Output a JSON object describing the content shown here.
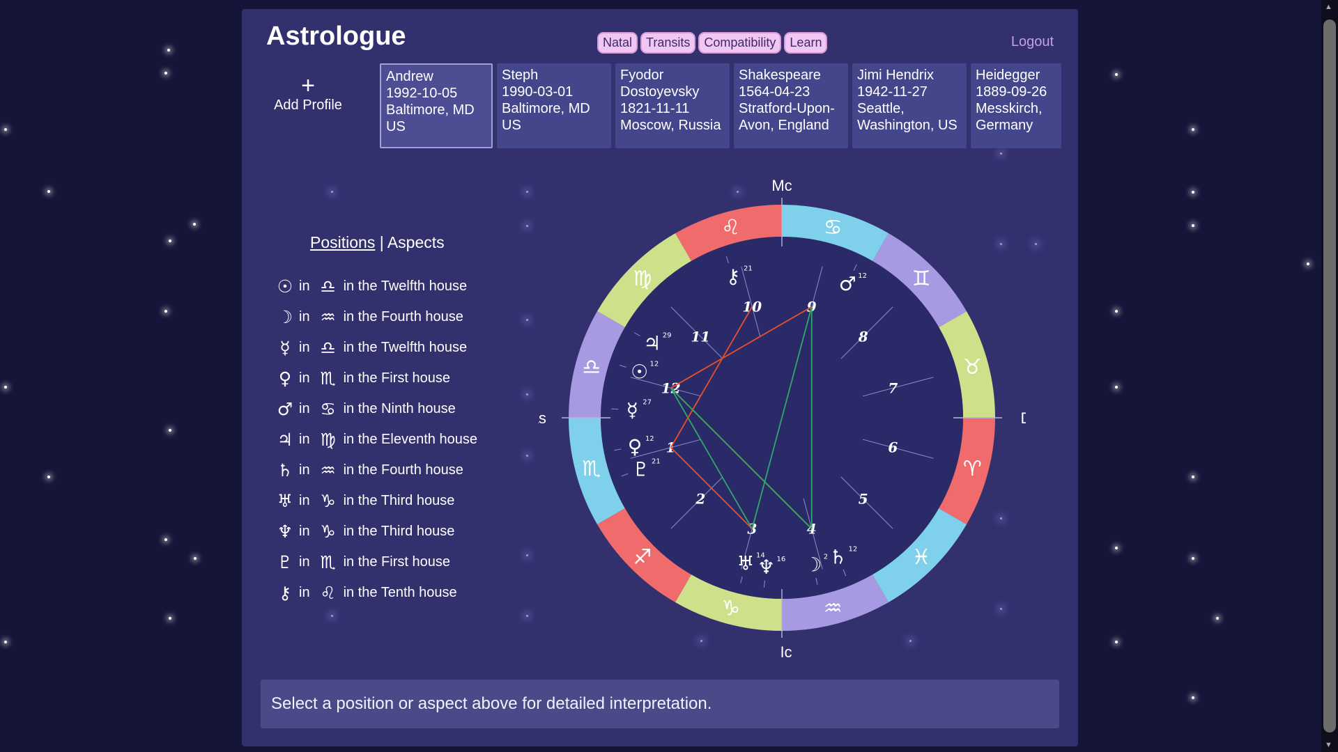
{
  "app": {
    "title": "Astrologue"
  },
  "nav": {
    "items": [
      "Natal",
      "Transits",
      "Compatibility",
      "Learn"
    ],
    "logout": "Logout"
  },
  "add_profile": {
    "icon": "+",
    "label": "Add Profile"
  },
  "profiles": [
    {
      "lines": [
        "Andrew",
        "1992-10-05",
        "Baltimore, MD",
        "US"
      ],
      "active": true
    },
    {
      "lines": [
        "Steph",
        "1990-03-01",
        "Baltimore, MD",
        "US"
      ],
      "active": false
    },
    {
      "lines": [
        "Fyodor",
        "Dostoyevsky",
        "1821-11-11",
        "Moscow, Russia"
      ],
      "active": false
    },
    {
      "lines": [
        "Shakespeare",
        "1564-04-23",
        "Stratford-Upon-",
        "Avon, England"
      ],
      "active": false
    },
    {
      "lines": [
        "Jimi Hendrix",
        "1942-11-27",
        "Seattle,",
        "Washington, US"
      ],
      "active": false
    },
    {
      "lines": [
        "Heidegger",
        "1889-09-26",
        "Messkirch,",
        "Germany"
      ],
      "active": false
    }
  ],
  "tabs": {
    "positions": "Positions",
    "separator": "|",
    "aspects": "Aspects"
  },
  "positions": [
    {
      "planet_icon": "sun-icon",
      "planet_glyph": "☉",
      "in": "in",
      "sign_icon": "libra-icon",
      "sign_glyph": "♎",
      "house": "in the Twelfth house"
    },
    {
      "planet_icon": "moon-icon",
      "planet_glyph": "☽",
      "in": "in",
      "sign_icon": "aquarius-icon",
      "sign_glyph": "♒",
      "house": "in the Fourth house"
    },
    {
      "planet_icon": "mercury-icon",
      "planet_glyph": "☿",
      "in": "in",
      "sign_icon": "libra-icon",
      "sign_glyph": "♎",
      "house": "in the Twelfth house"
    },
    {
      "planet_icon": "venus-icon",
      "planet_glyph": "♀",
      "in": "in",
      "sign_icon": "scorpio-icon",
      "sign_glyph": "♏",
      "house": "in the First house"
    },
    {
      "planet_icon": "mars-icon",
      "planet_glyph": "♂",
      "in": "in",
      "sign_icon": "cancer-icon",
      "sign_glyph": "♋",
      "house": "in the Ninth house"
    },
    {
      "planet_icon": "jupiter-icon",
      "planet_glyph": "♃",
      "in": "in",
      "sign_icon": "virgo-icon",
      "sign_glyph": "♍",
      "house": "in the Eleventh house"
    },
    {
      "planet_icon": "saturn-icon",
      "planet_glyph": "♄",
      "in": "in",
      "sign_icon": "aquarius-icon",
      "sign_glyph": "♒",
      "house": "in the Fourth house"
    },
    {
      "planet_icon": "uranus-icon",
      "planet_glyph": "♅",
      "in": "in",
      "sign_icon": "capricorn-icon",
      "sign_glyph": "♑",
      "house": "in the Third house"
    },
    {
      "planet_icon": "neptune-icon",
      "planet_glyph": "♆",
      "in": "in",
      "sign_icon": "capricorn-icon",
      "sign_glyph": "♑",
      "house": "in the Third house"
    },
    {
      "planet_icon": "pluto-icon",
      "planet_glyph": "♇",
      "in": "in",
      "sign_icon": "scorpio-icon",
      "sign_glyph": "♏",
      "house": "in the First house"
    },
    {
      "planet_icon": "chiron-icon",
      "planet_glyph": "⚷",
      "in": "in",
      "sign_icon": "leo-icon",
      "sign_glyph": "♌",
      "house": "in the Tenth house"
    }
  ],
  "chart": {
    "angles": {
      "mc": "Mc",
      "ic": "Ic",
      "as": "As",
      "ds": "Ds"
    },
    "signs": [
      {
        "name": "leo",
        "glyph": "♌",
        "color": "#f06b6b"
      },
      {
        "name": "virgo",
        "glyph": "♍",
        "color": "#cfe08a"
      },
      {
        "name": "libra",
        "glyph": "♎",
        "color": "#a799e2"
      },
      {
        "name": "scorpio",
        "glyph": "♏",
        "color": "#7fd0ea"
      },
      {
        "name": "sagittarius",
        "glyph": "♐",
        "color": "#f06b6b"
      },
      {
        "name": "capricorn",
        "glyph": "♑",
        "color": "#cfe08a"
      },
      {
        "name": "aquarius",
        "glyph": "♒",
        "color": "#a799e2"
      },
      {
        "name": "pisces",
        "glyph": "♓",
        "color": "#7fd0ea"
      },
      {
        "name": "aries",
        "glyph": "♈",
        "color": "#f06b6b"
      },
      {
        "name": "taurus",
        "glyph": "♉",
        "color": "#cfe08a"
      },
      {
        "name": "gemini",
        "glyph": "♊",
        "color": "#a799e2"
      },
      {
        "name": "cancer",
        "glyph": "♋",
        "color": "#7fd0ea"
      }
    ],
    "houses": [
      "1",
      "2",
      "3",
      "4",
      "5",
      "6",
      "7",
      "8",
      "9",
      "10",
      "11",
      "12"
    ],
    "planets": [
      {
        "name": "chiron",
        "glyph": "⚷",
        "degree": "21"
      },
      {
        "name": "mars",
        "glyph": "♂",
        "degree": "12"
      },
      {
        "name": "jupiter",
        "glyph": "♃",
        "degree": "29"
      },
      {
        "name": "sun",
        "glyph": "☉",
        "degree": "12"
      },
      {
        "name": "mercury",
        "glyph": "☿",
        "degree": "27"
      },
      {
        "name": "venus",
        "glyph": "♀",
        "degree": "12"
      },
      {
        "name": "pluto",
        "glyph": "♇",
        "degree": "21"
      },
      {
        "name": "uranus",
        "glyph": "♅",
        "degree": "14"
      },
      {
        "name": "neptune",
        "glyph": "♆",
        "degree": "16"
      },
      {
        "name": "moon",
        "glyph": "☽",
        "degree": "2"
      },
      {
        "name": "saturn",
        "glyph": "♄",
        "degree": "12"
      }
    ],
    "aspect_colors": {
      "red": "#e8502a",
      "green": "#2fa86a"
    }
  },
  "info": {
    "text": "Select a position or aspect above for detailed interpretation."
  },
  "colors": {
    "background": "#141538",
    "panel": "#33306e",
    "nav_button": "#f2c6f2"
  }
}
